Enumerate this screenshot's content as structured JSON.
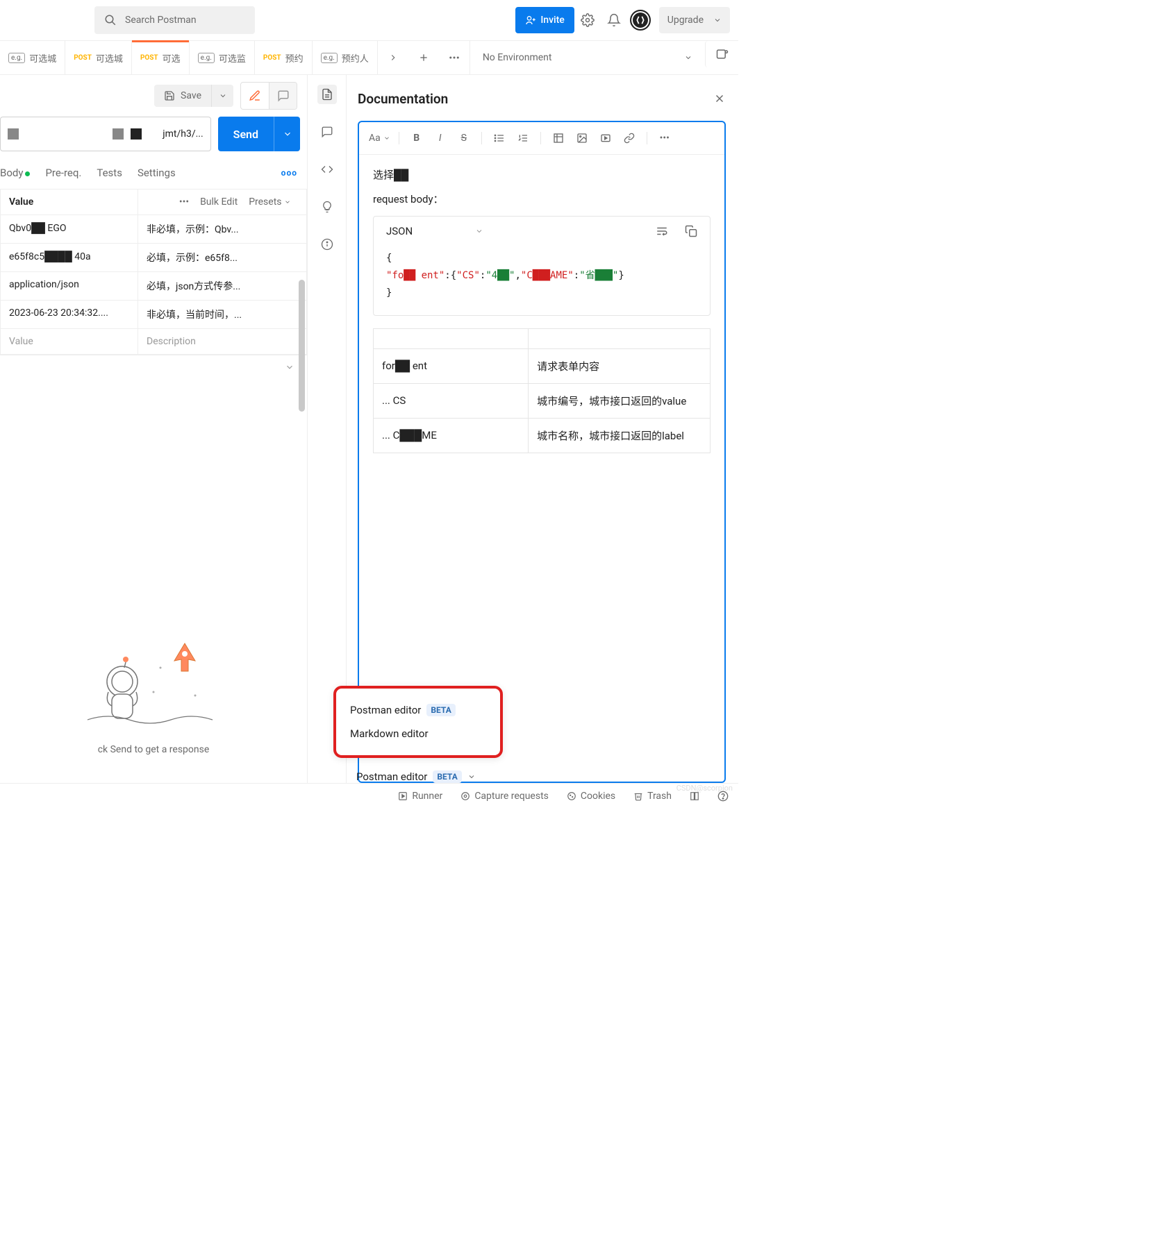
{
  "search": {
    "placeholder": "Search Postman"
  },
  "topbar": {
    "invite": "Invite",
    "upgrade": "Upgrade"
  },
  "tabs": [
    {
      "type": "eg",
      "label": "可选城"
    },
    {
      "type": "post",
      "label": "可选城"
    },
    {
      "type": "post",
      "label": "可选",
      "active": true
    },
    {
      "type": "eg",
      "label": "可选监"
    },
    {
      "type": "post",
      "label": "预约"
    },
    {
      "type": "eg",
      "label": "预约人"
    }
  ],
  "env": {
    "label": "No Environment"
  },
  "request": {
    "save": "Save",
    "url_tail": "jmt/h3/...",
    "send": "Send",
    "subtabs": {
      "body": "Body",
      "prereq": "Pre-req.",
      "tests": "Tests",
      "settings": "Settings"
    }
  },
  "params": {
    "header_value": "Value",
    "bulk_edit": "Bulk Edit",
    "presets": "Presets",
    "rows": [
      {
        "value": "Qbv0██ EGO",
        "desc": "非必填，示例：Qbv..."
      },
      {
        "value": "e65f8c5████ 40a",
        "desc": "必填，示例：e65f8..."
      },
      {
        "value": "application/json",
        "desc": "必填，json方式传参..."
      },
      {
        "value": "2023-06-23 20:34:32....",
        "desc": "非必填，当前时间，..."
      }
    ],
    "placeholder_value": "Value",
    "placeholder_desc": "Description"
  },
  "empty": {
    "hint": "ck Send to get a response"
  },
  "doc": {
    "title": "Documentation",
    "body_line1": "选择██",
    "body_line2": "request body：",
    "code_lang": "JSON",
    "code": {
      "open": "{",
      "k1": "\"fo██ ent\"",
      "k2": "\"CS\"",
      "v2": "\"4██\"",
      "k3": "\"C███AME\"",
      "v3": "\"省███\"",
      "close": "}"
    },
    "table": [
      {
        "k": "for██ ent",
        "v": "请求表单内容"
      },
      {
        "k": "... CS",
        "v": "城市编号，城市接口返回的value"
      },
      {
        "k": "... C███ME",
        "v": "城市名称，城市接口返回的label"
      }
    ]
  },
  "popup": {
    "opt1": "Postman editor",
    "beta": "BETA",
    "opt2": "Markdown editor"
  },
  "editor_dd": {
    "label": "Postman editor",
    "beta": "BETA"
  },
  "footer": {
    "runner": "Runner",
    "capture": "Capture requests",
    "cookies": "Cookies",
    "trash": "Trash"
  },
  "watermark": "CSDN@scorpion"
}
